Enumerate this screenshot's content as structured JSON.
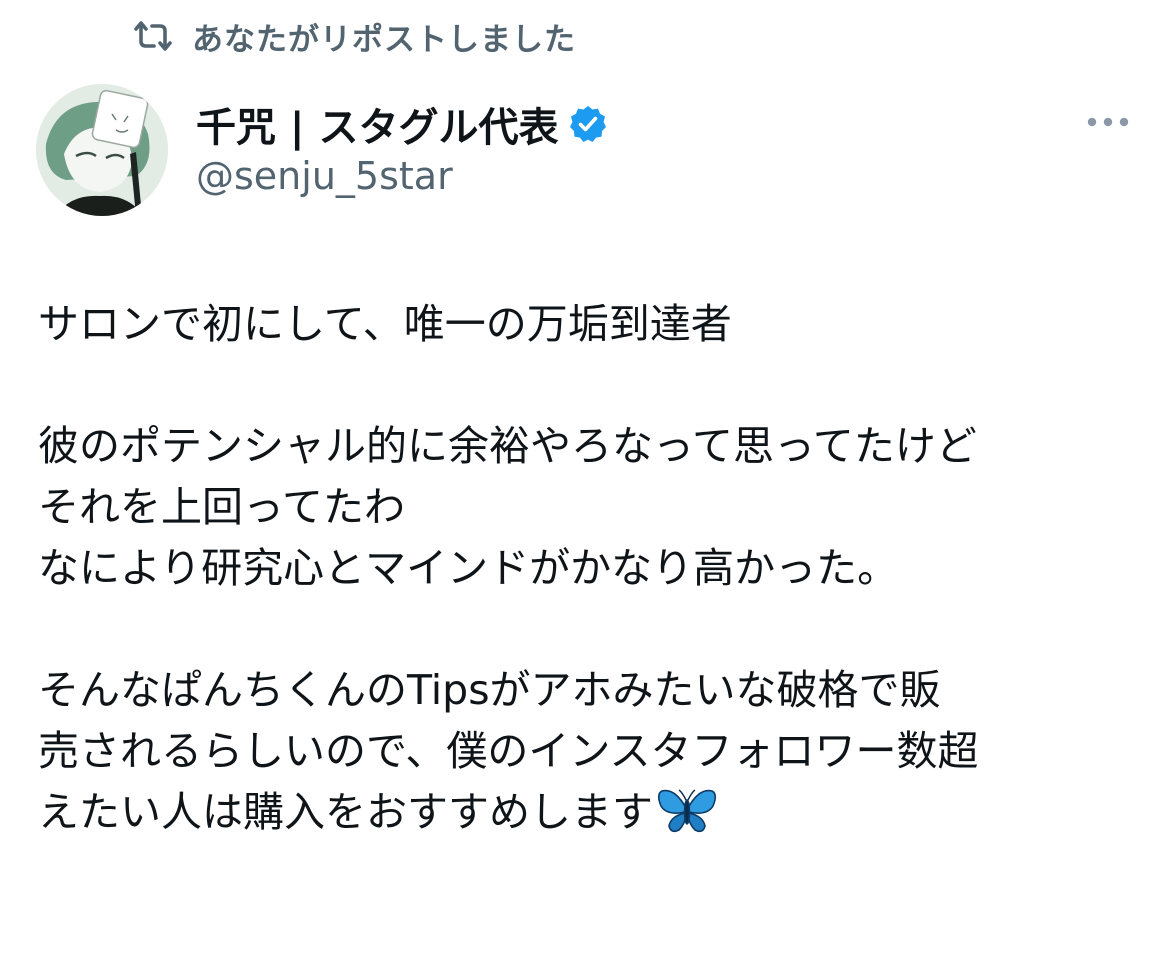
{
  "repost": {
    "icon": "repost-icon",
    "label": "あなたがリポストしました"
  },
  "author": {
    "avatar_icon": "avatar",
    "display_name": "千咒 | スタグル代表",
    "verified_icon": "verified-badge-icon",
    "handle": "@senju_5star",
    "more_icon": "more-horizontal-icon"
  },
  "tweet": {
    "lines": [
      "サロンで初にして、唯一の万垢到達者",
      "",
      "彼のポテンシャル的に余裕やろなって思ってたけど",
      "それを上回ってたわ",
      "なにより研究心とマインドがかなり高かった。",
      "",
      "そんなぱんちくんのTipsがアホみたいな破格で販",
      "売されるらしいので、僕のインスタフォロワー数超",
      "えたい人は購入をおすすめします"
    ],
    "trailing_emoji_icon": "butterfly-emoji-icon"
  },
  "colors": {
    "text_primary": "#0f1419",
    "text_secondary": "#536471",
    "verified_blue": "#1d9bf0",
    "background": "#ffffff"
  }
}
